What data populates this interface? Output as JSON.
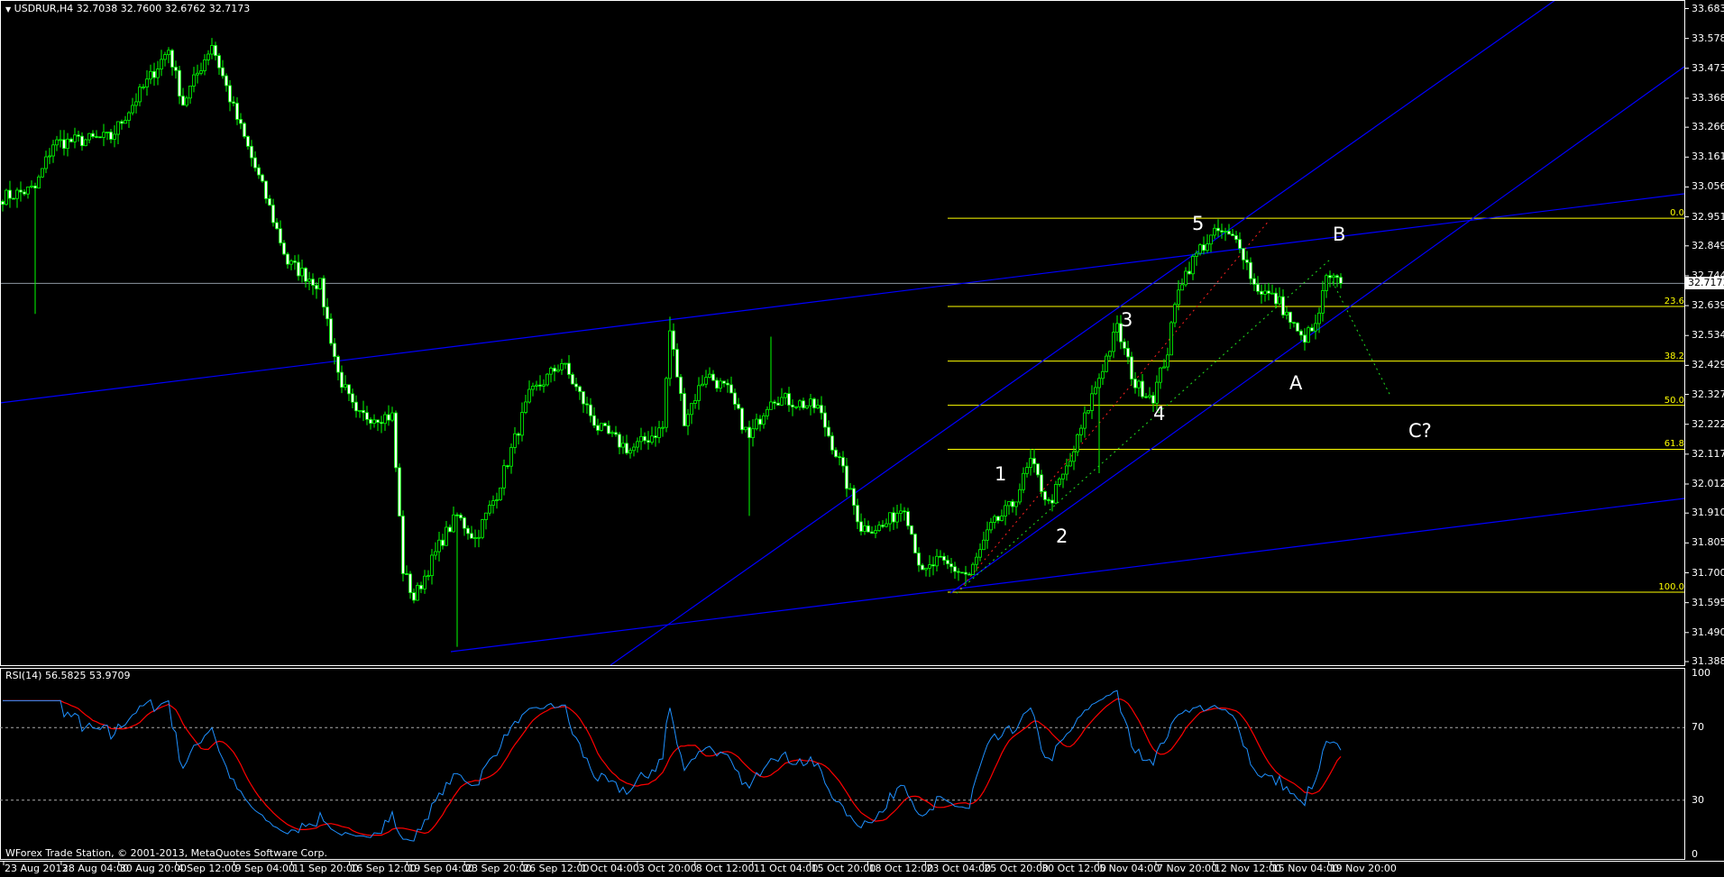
{
  "chart_header": {
    "symbol_tf": "USDRUR,H4",
    "open": "32.7038",
    "high": "32.7600",
    "low": "32.6762",
    "close": "32.7173"
  },
  "rsi_header": {
    "label": "RSI(14)",
    "value1": "56.5825",
    "value2": "53.9709"
  },
  "copyright": "WForex Trade Station, © 2001-2013, MetaQuotes Software Corp.",
  "colors": {
    "bull": "#00ff00",
    "line": "#0000ff",
    "fib": "#ffff00",
    "rsi": "#1e90ff",
    "rsi_ma": "#ff0000",
    "current": "#8c96a0"
  },
  "price_axis": [
    "33.6830",
    "33.5780",
    "33.4730",
    "33.3680",
    "33.2660",
    "33.1610",
    "33.0560",
    "32.9510",
    "32.8490",
    "32.7440",
    "32.6390",
    "32.5340",
    "32.4290",
    "32.3270",
    "32.2220",
    "32.1170",
    "32.0120",
    "31.9100",
    "31.8050",
    "31.7000",
    "31.5950",
    "31.4900",
    "31.3880"
  ],
  "current_price": "32.7173",
  "rsi_axis": [
    "100",
    "70",
    "30",
    "0"
  ],
  "time_axis": [
    "23 Aug 2013",
    "28 Aug 04:00",
    "30 Aug 20:00",
    "4 Sep 12:00",
    "9 Sep 04:00",
    "11 Sep 20:00",
    "16 Sep 12:00",
    "19 Sep 04:00",
    "23 Sep 20:00",
    "26 Sep 12:00",
    "1 Oct 04:00",
    "3 Oct 20:00",
    "8 Oct 12:00",
    "11 Oct 04:00",
    "15 Oct 20:00",
    "18 Oct 12:00",
    "23 Oct 04:00",
    "25 Oct 20:00",
    "30 Oct 12:00",
    "5 Nov 04:00",
    "7 Nov 20:00",
    "12 Nov 12:00",
    "15 Nov 04:00",
    "19 Nov 20:00"
  ],
  "fib_levels": [
    {
      "label": "0.0",
      "price": 32.946
    },
    {
      "label": "23.6",
      "price": 32.636
    },
    {
      "label": "38.2",
      "price": 32.444
    },
    {
      "label": "50.0",
      "price": 32.289
    },
    {
      "label": "61.8",
      "price": 32.134
    },
    {
      "label": "100.0",
      "price": 31.632
    }
  ],
  "wave_labels": {
    "w1": "1",
    "w2": "2",
    "w3": "3",
    "w4": "4",
    "w5": "5",
    "wa": "A",
    "wb": "B",
    "wc": "C?"
  },
  "chart_data": {
    "type": "candlestick",
    "timeframe": "H4",
    "price_range": [
      31.388,
      33.683
    ],
    "close_keypoints": [
      [
        0,
        33.02
      ],
      [
        9,
        33.05
      ],
      [
        14,
        33.21
      ],
      [
        30,
        33.23
      ],
      [
        46,
        33.54
      ],
      [
        50,
        33.35
      ],
      [
        58,
        33.56
      ],
      [
        64,
        33.33
      ],
      [
        73,
        33.02
      ],
      [
        79,
        32.79
      ],
      [
        88,
        32.71
      ],
      [
        93,
        32.4
      ],
      [
        98,
        32.25
      ],
      [
        108,
        32.25
      ],
      [
        111,
        31.71
      ],
      [
        114,
        31.61
      ],
      [
        122,
        31.82
      ],
      [
        126,
        31.9
      ],
      [
        131,
        31.82
      ],
      [
        137,
        31.98
      ],
      [
        146,
        32.32
      ],
      [
        155,
        32.44
      ],
      [
        165,
        32.21
      ],
      [
        174,
        32.13
      ],
      [
        183,
        32.21
      ],
      [
        185,
        32.55
      ],
      [
        189,
        32.24
      ],
      [
        195,
        32.4
      ],
      [
        201,
        32.34
      ],
      [
        207,
        32.17
      ],
      [
        213,
        32.32
      ],
      [
        226,
        32.28
      ],
      [
        232,
        32.09
      ],
      [
        238,
        31.86
      ],
      [
        244,
        31.86
      ],
      [
        250,
        31.94
      ],
      [
        255,
        31.69
      ],
      [
        259,
        31.74
      ],
      [
        268,
        31.69
      ],
      [
        274,
        31.86
      ],
      [
        280,
        31.94
      ],
      [
        285,
        32.09
      ],
      [
        290,
        31.94
      ],
      [
        296,
        32.09
      ],
      [
        302,
        32.32
      ],
      [
        309,
        32.56
      ],
      [
        314,
        32.36
      ],
      [
        319,
        32.32
      ],
      [
        323,
        32.48
      ],
      [
        326,
        32.71
      ],
      [
        332,
        32.84
      ],
      [
        337,
        32.9
      ],
      [
        343,
        32.86
      ],
      [
        347,
        32.71
      ],
      [
        354,
        32.65
      ],
      [
        360,
        32.52
      ],
      [
        364,
        32.56
      ],
      [
        367,
        32.73
      ],
      [
        371,
        32.7173
      ]
    ],
    "wick_spikes": [
      [
        9,
        "low",
        32.61
      ],
      [
        126,
        "low",
        31.44
      ],
      [
        185,
        "high",
        32.6
      ],
      [
        207,
        "low",
        31.9
      ],
      [
        213,
        "high",
        32.53
      ],
      [
        304,
        "low",
        32.05
      ]
    ],
    "rsi_period": 14,
    "rsi_levels": [
      70,
      30
    ]
  }
}
